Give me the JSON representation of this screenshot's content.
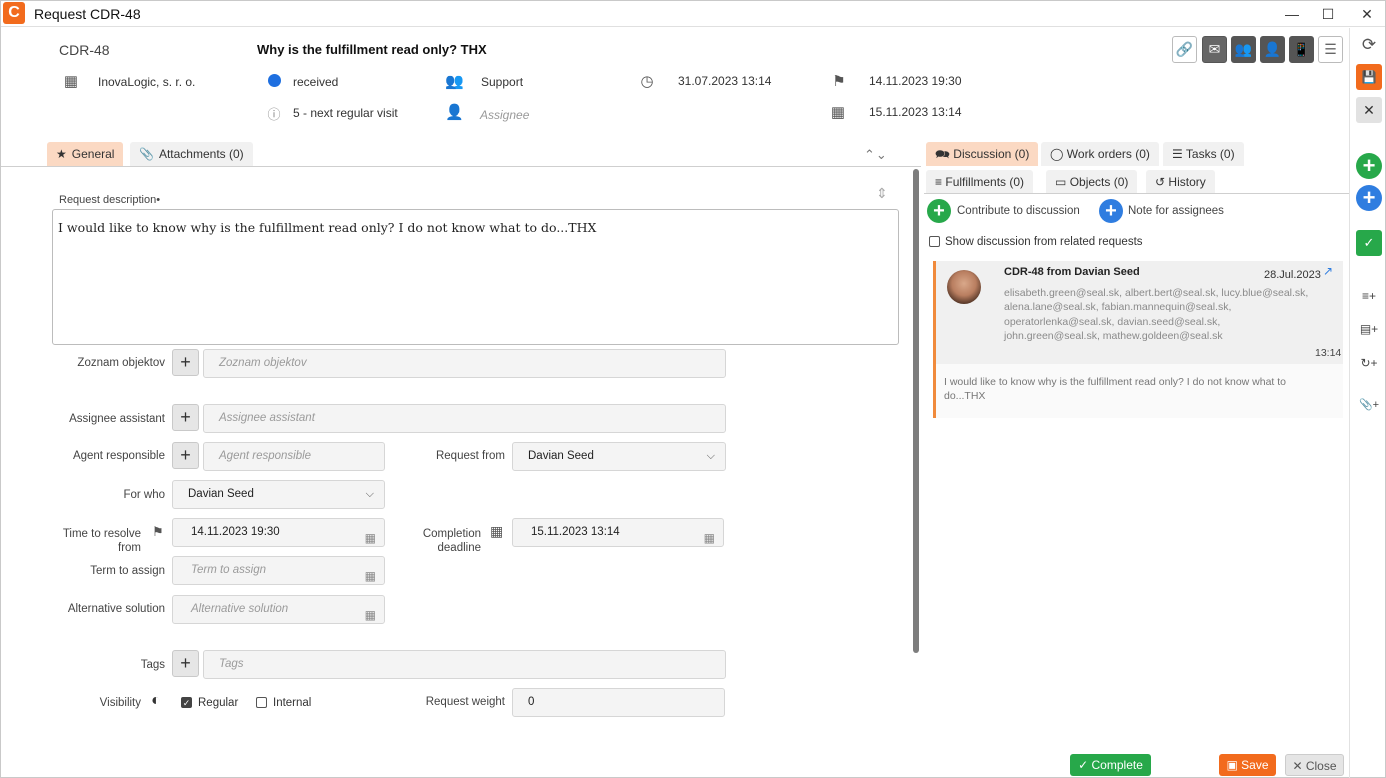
{
  "window": {
    "title": "Request CDR-48",
    "logo_letter": "C",
    "minimize": "—",
    "maximize": "☐",
    "close": "✕"
  },
  "header": {
    "id": "CDR-48",
    "subject": "Why is the fulfillment read only? THX",
    "company": "InovaLogic, s. r. o.",
    "status": "received",
    "priority": "5 - next regular visit",
    "group": "Support",
    "assignee_placeholder": "Assignee",
    "created": "31.07.2023 13:14",
    "resolve_from": "14.11.2023 19:30",
    "deadline": "15.11.2023 13:14"
  },
  "toolbar": {
    "link": "🔗",
    "mail": "✉",
    "team": "👥",
    "person": "👤",
    "mobile": "📱",
    "menu": "☰"
  },
  "side": {
    "refresh": "⟳",
    "save": "💾",
    "close": "✕",
    "add_green": "+",
    "add_blue": "+",
    "done": "✓",
    "add_list": "≡+",
    "add_table": "▤+",
    "add_cycle": "↻+",
    "add_attach": "📎+"
  },
  "left_tabs": [
    {
      "icon": "★",
      "label": "General"
    },
    {
      "icon": "📎",
      "label": "Attachments (0)"
    }
  ],
  "collapse_icons": "⌃⌄",
  "form": {
    "desc_label": "Request description•",
    "desc_text": "I would like to know why is the fulfillment read only? I do not know what to do...THX",
    "zoznam_label": "Zoznam objektov",
    "zoznam_ph": "Zoznam objektov",
    "assistant_label": "Assignee assistant",
    "assistant_ph": "Assignee assistant",
    "agent_label": "Agent responsible",
    "agent_ph": "Agent responsible",
    "request_from_label": "Request from",
    "request_from_value": "Davian Seed",
    "for_who_label": "For who",
    "for_who_value": "Davian Seed",
    "resolve_label": "Time to resolve from",
    "resolve_value": "14.11.2023 19:30",
    "completion_label": "Completion deadline",
    "completion_value": "15.11.2023 13:14",
    "term_label": "Term to assign",
    "term_ph": "Term to assign",
    "alt_label": "Alternative solution",
    "alt_ph": "Alternative solution",
    "tags_label": "Tags",
    "tags_ph": "Tags",
    "visibility_label": "Visibility",
    "regular_label": "Regular",
    "internal_label": "Internal",
    "weight_label": "Request weight",
    "weight_value": "0"
  },
  "right_tabs_row1": [
    {
      "icon": "🗪",
      "label": "Discussion (0)"
    },
    {
      "icon": "◯",
      "label": "Work orders (0)"
    },
    {
      "icon": "☰",
      "label": "Tasks (0)"
    }
  ],
  "right_tabs_row2": [
    {
      "icon": "≡",
      "label": "Fulfillments (0)"
    },
    {
      "icon": "▭",
      "label": "Objects (0)"
    },
    {
      "icon": "↺",
      "label": "History"
    }
  ],
  "discussion": {
    "contribute": "Contribute to discussion",
    "note": "Note for assignees",
    "show_related": "Show discussion from related requests",
    "msg_title": "CDR-48 from Davian Seed",
    "msg_date": "28.Jul.2023",
    "recipients_1": "elisabeth.green@seal.sk, albert.bert@seal.sk, lucy.blue@seal.sk,",
    "recipients_2": "alena.lane@seal.sk, fabian.mannequin@seal.sk,",
    "recipients_3": "operatorlenka@seal.sk, davian.seed@seal.sk,",
    "recipients_4": "john.green@seal.sk, mathew.goldeen@seal.sk",
    "msg_time": "13:14",
    "msg_body_1": "I would like to know why is the fulfillment read only? I do not know what to",
    "msg_body_2": "do...THX"
  },
  "footer": {
    "complete": "Complete",
    "save": "Save",
    "close": "Close"
  },
  "colors": {
    "accent": "#f26b1d",
    "green": "#27a84a",
    "blue": "#1e6fe0",
    "tab_active": "#fbd9c3"
  }
}
